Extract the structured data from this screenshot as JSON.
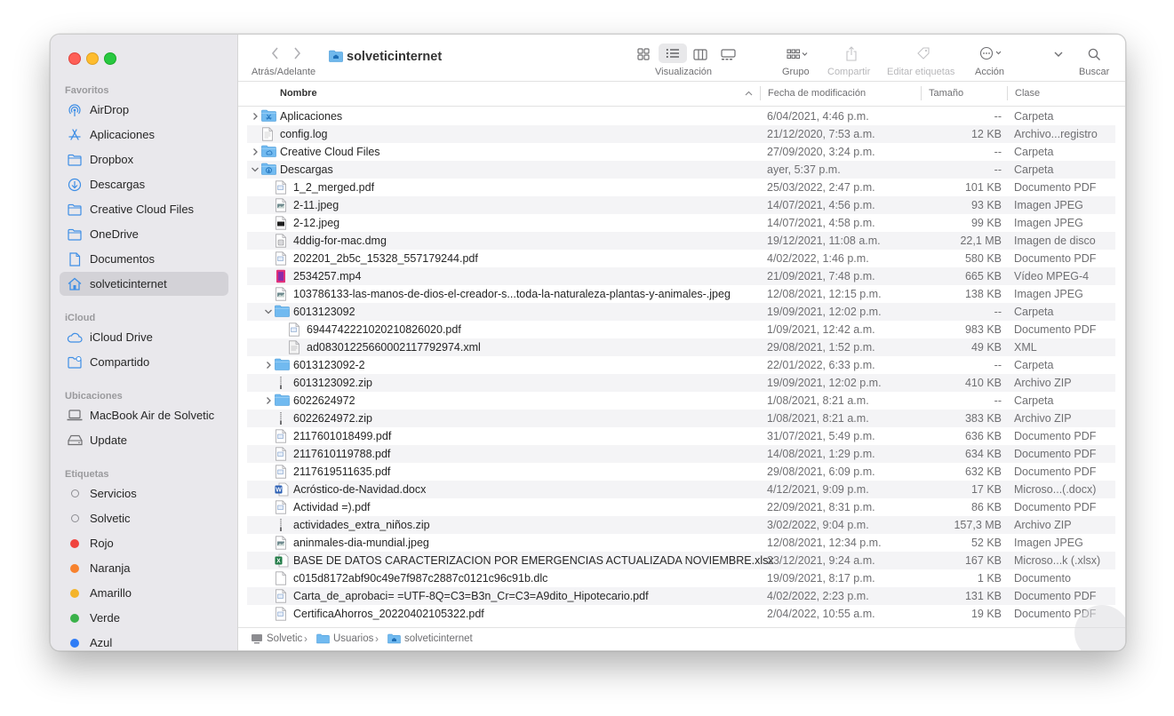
{
  "sidebar": {
    "sections": [
      {
        "title": "Favoritos",
        "items": [
          {
            "label": "AirDrop",
            "icon": "airdrop-icon"
          },
          {
            "label": "Aplicaciones",
            "icon": "applications-icon"
          },
          {
            "label": "Dropbox",
            "icon": "folder-icon"
          },
          {
            "label": "Descargas",
            "icon": "downloads-icon"
          },
          {
            "label": "Creative Cloud Files",
            "icon": "folder-icon"
          },
          {
            "label": "OneDrive",
            "icon": "folder-icon"
          },
          {
            "label": "Documentos",
            "icon": "document-icon"
          },
          {
            "label": "solveticinternet",
            "icon": "home-icon",
            "selected": true
          }
        ]
      },
      {
        "title": "iCloud",
        "items": [
          {
            "label": "iCloud Drive",
            "icon": "cloud-icon"
          },
          {
            "label": "Compartido",
            "icon": "shared-folder-icon"
          }
        ]
      },
      {
        "title": "Ubicaciones",
        "items": [
          {
            "label": "MacBook Air de Solvetic",
            "icon": "laptop-icon"
          },
          {
            "label": "Update",
            "icon": "disk-icon"
          }
        ]
      },
      {
        "title": "Etiquetas",
        "items": [
          {
            "label": "Servicios",
            "color": "hollow"
          },
          {
            "label": "Solvetic",
            "color": "hollow"
          },
          {
            "label": "Rojo",
            "color": "#f0443e"
          },
          {
            "label": "Naranja",
            "color": "#f7822e"
          },
          {
            "label": "Amarillo",
            "color": "#f4b42a"
          },
          {
            "label": "Verde",
            "color": "#3ab14a"
          },
          {
            "label": "Azul",
            "color": "#2f7cf6"
          }
        ]
      }
    ]
  },
  "toolbar": {
    "nav_label": "Atrás/Adelante",
    "title": "solveticinternet",
    "view_label": "Visualización",
    "group_label": "Grupo",
    "share_label": "Compartir",
    "tags_label": "Editar etiquetas",
    "action_label": "Acción",
    "search_label": "Buscar"
  },
  "columns": {
    "name": "Nombre",
    "date": "Fecha de modificación",
    "size": "Tamaño",
    "kind": "Clase"
  },
  "rows": [
    {
      "name": "Aplicaciones",
      "date": "6/04/2021, 4:46 p.m.",
      "size": "--",
      "kind": "Carpeta",
      "level": 0,
      "disclosure": "closed",
      "icon": "folder-apps"
    },
    {
      "name": "config.log",
      "date": "21/12/2020, 7:53 a.m.",
      "size": "12 KB",
      "kind": "Archivo...registro",
      "level": 0,
      "icon": "file-log"
    },
    {
      "name": "Creative Cloud Files",
      "date": "27/09/2020, 3:24 p.m.",
      "size": "--",
      "kind": "Carpeta",
      "level": 0,
      "disclosure": "closed",
      "icon": "folder-cc"
    },
    {
      "name": "Descargas",
      "date": "ayer, 5:37 p.m.",
      "size": "--",
      "kind": "Carpeta",
      "level": 0,
      "disclosure": "open",
      "icon": "folder-downloads"
    },
    {
      "name": "1_2_merged.pdf",
      "date": "25/03/2022, 2:47 p.m.",
      "size": "101 KB",
      "kind": "Documento PDF",
      "level": 1,
      "icon": "file-pdf"
    },
    {
      "name": "2-11.jpeg",
      "date": "14/07/2021, 4:56 p.m.",
      "size": "93 KB",
      "kind": "Imagen JPEG",
      "level": 1,
      "icon": "file-image"
    },
    {
      "name": "2-12.jpeg",
      "date": "14/07/2021, 4:58 p.m.",
      "size": "99 KB",
      "kind": "Imagen JPEG",
      "level": 1,
      "icon": "file-image-dark"
    },
    {
      "name": "4ddig-for-mac.dmg",
      "date": "19/12/2021, 11:08 a.m.",
      "size": "22,1 MB",
      "kind": "Imagen de disco",
      "level": 1,
      "icon": "file-dmg"
    },
    {
      "name": "202201_2b5c_15328_557179244.pdf",
      "date": "4/02/2022, 1:46 p.m.",
      "size": "580 KB",
      "kind": "Documento PDF",
      "level": 1,
      "icon": "file-pdf"
    },
    {
      "name": "2534257.mp4",
      "date": "21/09/2021, 7:48 p.m.",
      "size": "665 KB",
      "kind": "Vídeo MPEG-4",
      "level": 1,
      "icon": "file-video"
    },
    {
      "name": "103786133-las-manos-de-dios-el-creador-s...toda-la-naturaleza-plantas-y-animales-.jpeg",
      "date": "12/08/2021, 12:15 p.m.",
      "size": "138 KB",
      "kind": "Imagen JPEG",
      "level": 1,
      "icon": "file-image"
    },
    {
      "name": "6013123092",
      "date": "19/09/2021, 12:02 p.m.",
      "size": "--",
      "kind": "Carpeta",
      "level": 1,
      "disclosure": "open",
      "icon": "folder"
    },
    {
      "name": "6944742221020210826020.pdf",
      "date": "1/09/2021, 12:42 a.m.",
      "size": "983 KB",
      "kind": "Documento PDF",
      "level": 2,
      "icon": "file-pdf"
    },
    {
      "name": "ad08301225660002117792974.xml",
      "date": "29/08/2021, 1:52 p.m.",
      "size": "49 KB",
      "kind": "XML",
      "level": 2,
      "icon": "file-xml"
    },
    {
      "name": "6013123092-2",
      "date": "22/01/2022, 6:33 p.m.",
      "size": "--",
      "kind": "Carpeta",
      "level": 1,
      "disclosure": "closed",
      "icon": "folder"
    },
    {
      "name": "6013123092.zip",
      "date": "19/09/2021, 12:02 p.m.",
      "size": "410 KB",
      "kind": "Archivo ZIP",
      "level": 1,
      "icon": "file-zip"
    },
    {
      "name": "6022624972",
      "date": "1/08/2021, 8:21 a.m.",
      "size": "--",
      "kind": "Carpeta",
      "level": 1,
      "disclosure": "closed",
      "icon": "folder"
    },
    {
      "name": "6022624972.zip",
      "date": "1/08/2021, 8:21 a.m.",
      "size": "383 KB",
      "kind": "Archivo ZIP",
      "level": 1,
      "icon": "file-zip"
    },
    {
      "name": "2117601018499.pdf",
      "date": "31/07/2021, 5:49 p.m.",
      "size": "636 KB",
      "kind": "Documento PDF",
      "level": 1,
      "icon": "file-pdf"
    },
    {
      "name": "2117610119788.pdf",
      "date": "14/08/2021, 1:29 p.m.",
      "size": "634 KB",
      "kind": "Documento PDF",
      "level": 1,
      "icon": "file-pdf"
    },
    {
      "name": "2117619511635.pdf",
      "date": "29/08/2021, 6:09 p.m.",
      "size": "632 KB",
      "kind": "Documento PDF",
      "level": 1,
      "icon": "file-pdf"
    },
    {
      "name": "Acróstico-de-Navidad.docx",
      "date": "4/12/2021, 9:09 p.m.",
      "size": "17 KB",
      "kind": "Microso...(.docx)",
      "level": 1,
      "icon": "file-word"
    },
    {
      "name": "Actividad =).pdf",
      "date": "22/09/2021, 8:31 p.m.",
      "size": "86 KB",
      "kind": "Documento PDF",
      "level": 1,
      "icon": "file-pdf"
    },
    {
      "name": "actividades_extra_niños.zip",
      "date": "3/02/2022, 9:04 p.m.",
      "size": "157,3 MB",
      "kind": "Archivo ZIP",
      "level": 1,
      "icon": "file-zip"
    },
    {
      "name": "aninmales-dia-mundial.jpeg",
      "date": "12/08/2021, 12:34 p.m.",
      "size": "52 KB",
      "kind": "Imagen JPEG",
      "level": 1,
      "icon": "file-image"
    },
    {
      "name": "BASE DE DATOS CARACTERIZACION POR EMERGENCIAS ACTUALIZADA NOVIEMBRE.xlsx",
      "date": "23/12/2021, 9:24 a.m.",
      "size": "167 KB",
      "kind": "Microso...k (.xlsx)",
      "level": 1,
      "icon": "file-excel"
    },
    {
      "name": "c015d8172abf90c49e7f987c2887c0121c96c91b.dlc",
      "date": "19/09/2021, 8:17 p.m.",
      "size": "1 KB",
      "kind": "Documento",
      "level": 1,
      "icon": "file-blank"
    },
    {
      "name": "Carta_de_aprobaci= =UTF-8Q=C3=B3n_Cr=C3=A9dito_Hipotecario.pdf",
      "date": "4/02/2022, 2:23 p.m.",
      "size": "131 KB",
      "kind": "Documento PDF",
      "level": 1,
      "icon": "file-pdf"
    },
    {
      "name": "CertificaAhorros_20220402105322.pdf",
      "date": "2/04/2022, 10:55 a.m.",
      "size": "19 KB",
      "kind": "Documento PDF",
      "level": 1,
      "icon": "file-pdf"
    }
  ],
  "pathbar": {
    "crumbs": [
      "Solvetic",
      "Usuarios",
      "solveticinternet"
    ]
  }
}
